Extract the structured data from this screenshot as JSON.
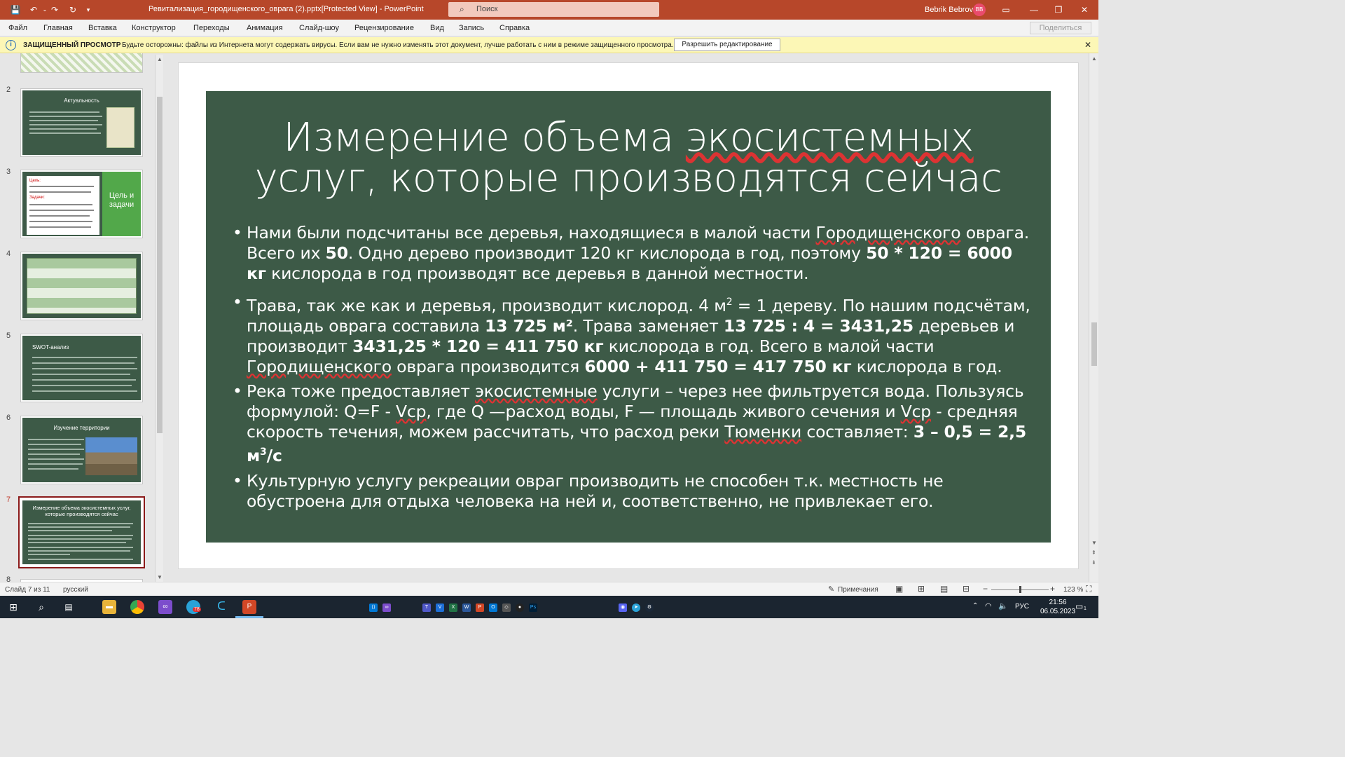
{
  "titlebar": {
    "document_title": "Ревитализация_городищенского_оврага (2).pptx[Protected View]  -  PowerPoint",
    "search_placeholder": "Поиск",
    "user_name": "Bebrik Bebrov",
    "user_initials": "BB"
  },
  "ribbon": {
    "tabs": [
      "Файл",
      "Главная",
      "Вставка",
      "Конструктор",
      "Переходы",
      "Анимация",
      "Слайд-шоу",
      "Рецензирование",
      "Вид",
      "Запись",
      "Справка"
    ],
    "share_label": "Поделиться"
  },
  "message_bar": {
    "title": "ЗАЩИЩЕННЫЙ ПРОСМОТР",
    "text": "Будьте осторожны: файлы из Интернета могут содержать вирусы. Если вам не нужно изменять этот документ, лучше работать с ним в режиме защищенного просмотра.",
    "enable_button": "Разрешить редактирование"
  },
  "thumbnails": [
    {
      "number": "2",
      "title": "Актуальность"
    },
    {
      "number": "3",
      "title": "Цель и задачи"
    },
    {
      "number": "4",
      "title": ""
    },
    {
      "number": "5",
      "title": "SWOT-анализ"
    },
    {
      "number": "6",
      "title": "Изучение территории"
    },
    {
      "number": "7",
      "title": "Измерение объема экосистемных услуг, которые производятся сейчас"
    },
    {
      "number": "8",
      "title": ""
    }
  ],
  "slide": {
    "title_line1_a": "Измерение объема ",
    "title_line1_b": "экосистемных",
    "title_line2": "услуг, которые производятся сейчас",
    "b1": {
      "p1": "Нами были подсчитаны все деревья, находящиеся в малой части ",
      "u1": "Городищенского",
      "p2": " оврага. Всего их ",
      "s1": "50",
      "p3": ". Одно дерево производит 120 кг кислорода в год, поэтому ",
      "s2": "50 * 120 = 6000 кг",
      "p4": " кислорода в год производят все деревья в данной местности."
    },
    "b2": {
      "p1": "Трава, так же как и деревья, производит кислород. 4 м",
      "sup1": "2",
      "p2": " = 1 дереву. По нашим подсчётам, площадь оврага составила ",
      "s1": "13 725 м²",
      "p3": ". Трава заменяет ",
      "s2": "13 725 :  4 = 3431,25",
      "p4": " деревьев и производит ",
      "s3": "3431,25 * 120 = 411 750 кг",
      "p5": " кислорода в год. Всего в малой части ",
      "u1": "Городищенского",
      "p6": " оврага производится ",
      "s4": "6000 + 411 750 = 417 750 кг",
      "p7": " кислорода в год."
    },
    "b3": {
      "p1": "Река тоже предоставляет ",
      "u1": "экосистемные",
      "p2": " услуги – через нее фильтруется вода. Пользуясь формулой: Q=F - ",
      "u2": "Vср",
      "p3": ", где Q —расход воды, F — площадь живого сечения и ",
      "u3": "Vср",
      "p4": " - средняя скорость течения, можем рассчитать, что расход реки ",
      "u4": "Тюменки",
      "p5": " составляет:  ",
      "s1": "3 – 0,5 = 2,5 м",
      "sup1": "3",
      "s2": "/с"
    },
    "b4": {
      "p1": "Культурную услугу рекреации овраг производить не способен т.к. местность не обустроена для отдыха человека на ней и, соответственно, не привлекает его."
    }
  },
  "statusbar": {
    "slide_info": "Слайд 7 из 11",
    "language": "русский",
    "notes_label": "Примечания",
    "zoom": "123 %"
  },
  "taskbar": {
    "lang": "РУС",
    "time": "21:56",
    "date": "06.05.2023",
    "badge": "78",
    "notif_count": "1"
  },
  "colors": {
    "accent": "#b7472a",
    "slide_bg": "#3d5a47",
    "selected_thumb": "#8b1a1a"
  }
}
